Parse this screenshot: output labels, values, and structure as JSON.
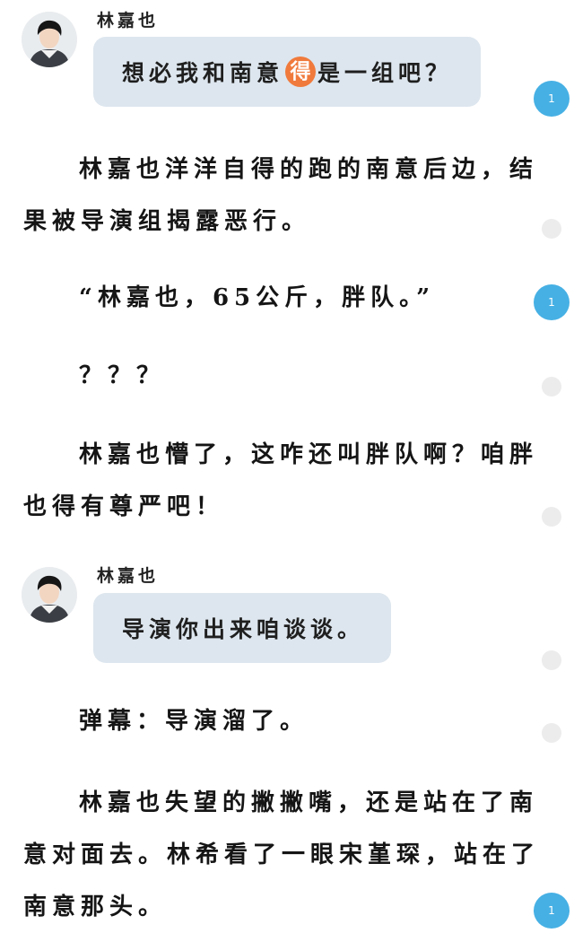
{
  "dialog1": {
    "speaker": "林嘉也",
    "text_before": "想必我和南意",
    "highlight": "得",
    "text_after": "是一组吧？"
  },
  "paragraphs": [
    {
      "lines": [
        "林嘉也洋洋自得的跑的南意后边，结",
        "果被导演组揭露恶行。"
      ]
    },
    {
      "lines": [
        "“林嘉也，65公斤，胖队。”"
      ]
    },
    {
      "lines": [
        "？？？"
      ]
    },
    {
      "lines": [
        "林嘉也懵了，这咋还叫胖队啊？咱胖",
        "也得有尊严吧！"
      ]
    }
  ],
  "dialog2": {
    "speaker": "林嘉也",
    "text": "导演你出来咱谈谈。"
  },
  "paragraphs2": [
    {
      "lines": [
        "弹幕：导演溜了。"
      ]
    },
    {
      "lines": [
        "林嘉也失望的撇撇嘴，还是站在了南",
        "意对面去。林希看了一眼宋堇琛，站在了",
        "南意那头。"
      ]
    }
  ],
  "comment_badges": [
    "1",
    "1",
    "1"
  ],
  "colors": {
    "bubble": "#dde6ee",
    "badge": "#46b0e4",
    "highlight": "#f07a3c",
    "dot": "#ececec"
  }
}
